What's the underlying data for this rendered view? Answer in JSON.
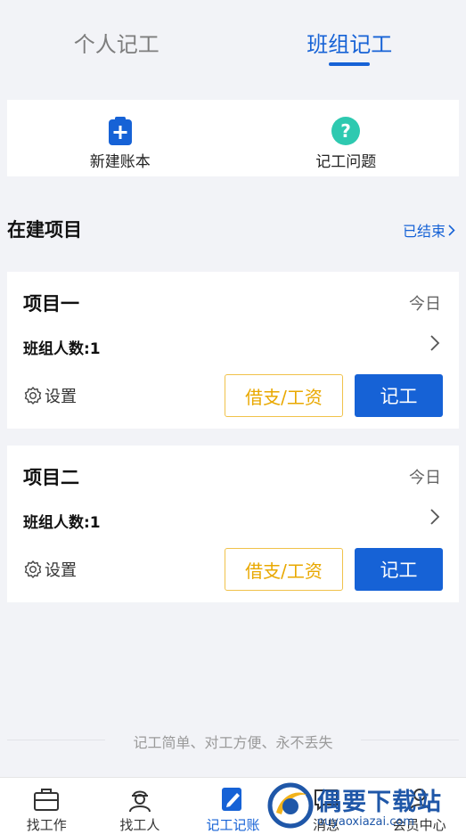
{
  "top_tabs": [
    {
      "label": "个人记工",
      "active": false
    },
    {
      "label": "班组记工",
      "active": true
    }
  ],
  "quick_actions": [
    {
      "label": "新建账本",
      "icon": "clipboard-plus-icon",
      "color": "#1662d6"
    },
    {
      "label": "记工问题",
      "icon": "question-icon",
      "color": "#2ec9b0"
    }
  ],
  "section": {
    "title": "在建项目",
    "link": "已结束"
  },
  "projects": [
    {
      "name": "项目一",
      "date": "今日",
      "members": "班组人数:1",
      "settings": "设置",
      "loan_btn": "借支/工资",
      "record_btn": "记工"
    },
    {
      "name": "项目二",
      "date": "今日",
      "members": "班组人数:1",
      "settings": "设置",
      "loan_btn": "借支/工资",
      "record_btn": "记工"
    }
  ],
  "slogan": "记工简单、对工方便、永不丢失",
  "bottom_nav": [
    {
      "label": "找工作",
      "icon": "briefcase-icon",
      "active": false
    },
    {
      "label": "找工人",
      "icon": "worker-icon",
      "active": false
    },
    {
      "label": "记工记账",
      "icon": "note-pen-icon",
      "active": true
    },
    {
      "label": "消息",
      "icon": "message-icon",
      "active": false
    },
    {
      "label": "会员中心",
      "icon": "member-icon",
      "active": false
    }
  ],
  "watermark": {
    "main": "偶要下载站",
    "sub": "ouyaoxiazai.com"
  },
  "colors": {
    "accent": "#1662d6",
    "loan": "#e9a800",
    "help": "#2ec9b0"
  }
}
